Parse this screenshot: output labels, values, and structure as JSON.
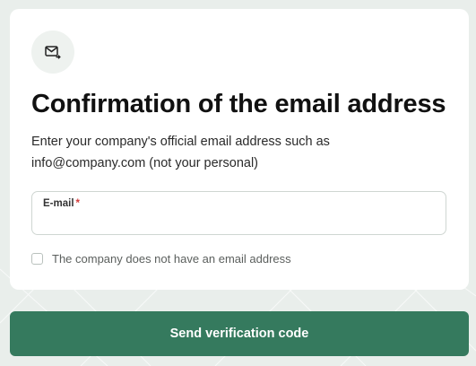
{
  "card": {
    "title": "Confirmation of the email address",
    "description": "Enter your company's official email address such as info@company.com (not your personal)",
    "icon": "email-send-icon"
  },
  "email_field": {
    "label": "E-mail",
    "required_marker": "*",
    "value": ""
  },
  "no_email_checkbox": {
    "label": "The company does not have an email address",
    "checked": false
  },
  "submit_button": {
    "label": "Send verification code"
  },
  "colors": {
    "accent": "#357a5e",
    "background": "#e9eeeb",
    "required": "#d23b3b"
  }
}
